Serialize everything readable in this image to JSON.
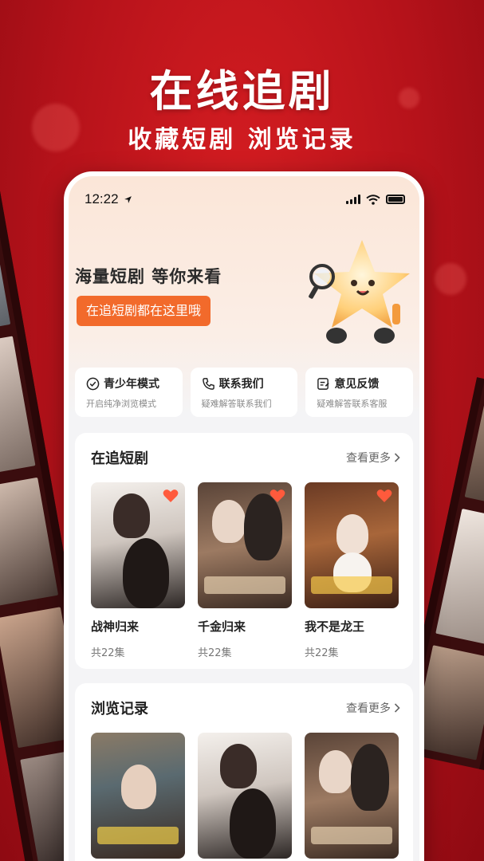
{
  "promo": {
    "title": "在线追剧",
    "subtitle": "收藏短剧  浏览记录"
  },
  "status_bar": {
    "time": "12:22"
  },
  "banner": {
    "title": "海量短剧 等你来看",
    "button_label": "在追短剧都在这里哦"
  },
  "quick_actions": [
    {
      "icon": "shield-check-icon",
      "title": "青少年模式",
      "subtitle": "开启纯净浏览模式"
    },
    {
      "icon": "phone-icon",
      "title": "联系我们",
      "subtitle": "疑难解答联系我们"
    },
    {
      "icon": "feedback-icon",
      "title": "意见反馈",
      "subtitle": "疑难解答联系客服"
    }
  ],
  "watching": {
    "title": "在追短剧",
    "more_label": "查看更多",
    "items": [
      {
        "title": "战神归来",
        "episodes": "共22集",
        "favorited": true
      },
      {
        "title": "千金归来",
        "episodes": "共22集",
        "favorited": true
      },
      {
        "title": "我不是龙王",
        "episodes": "共22集",
        "favorited": true
      }
    ]
  },
  "history": {
    "title": "浏览记录",
    "more_label": "查看更多"
  },
  "colors": {
    "brand_red": "#c8151c",
    "accent_orange": "#f26a2b",
    "heart": "#ff5a3c"
  }
}
